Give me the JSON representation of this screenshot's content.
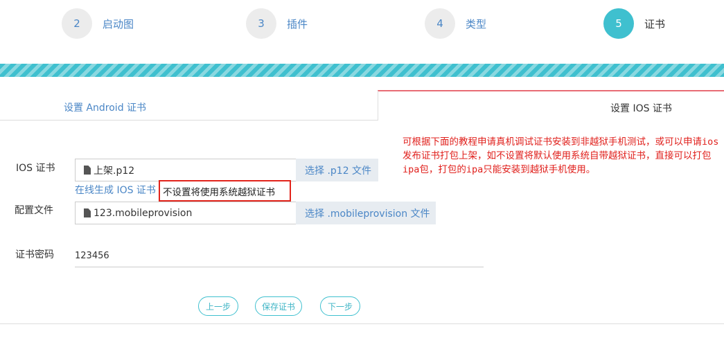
{
  "steps": [
    {
      "num": "2",
      "label": "启动图"
    },
    {
      "num": "3",
      "label": "插件"
    },
    {
      "num": "4",
      "label": "类型"
    },
    {
      "num": "5",
      "label": "证书"
    }
  ],
  "tabs": {
    "android": "设置 Android 证书",
    "ios": "设置 IOS 证书"
  },
  "note": "可根据下面的教程申请真机调试证书安装到非越狱手机测试，或可以申请ios发布证书打包上架，如不设置将默认使用系统自带越狱证书，直接可以打包ipa包，打包的ipa只能安装到越狱手机使用。",
  "ios_cert": {
    "label": "IOS 证书",
    "file": "上架.p12",
    "button": "选择 .p12 文件",
    "link": "在线生成 IOS 证书",
    "hint": "不设置将使用系统越狱证书"
  },
  "profile": {
    "label": "配置文件",
    "file": "123.mobileprovision",
    "button": "选择 .mobileprovision 文件"
  },
  "password": {
    "label": "证书密码",
    "value": "123456"
  },
  "buttons": {
    "prev": "上一步",
    "save": "保存证书",
    "next": "下一步"
  },
  "colors": {
    "accent": "#3fc0cf",
    "link": "#4a86c6",
    "note": "#e0201c",
    "active_tab": "#e86b74"
  }
}
